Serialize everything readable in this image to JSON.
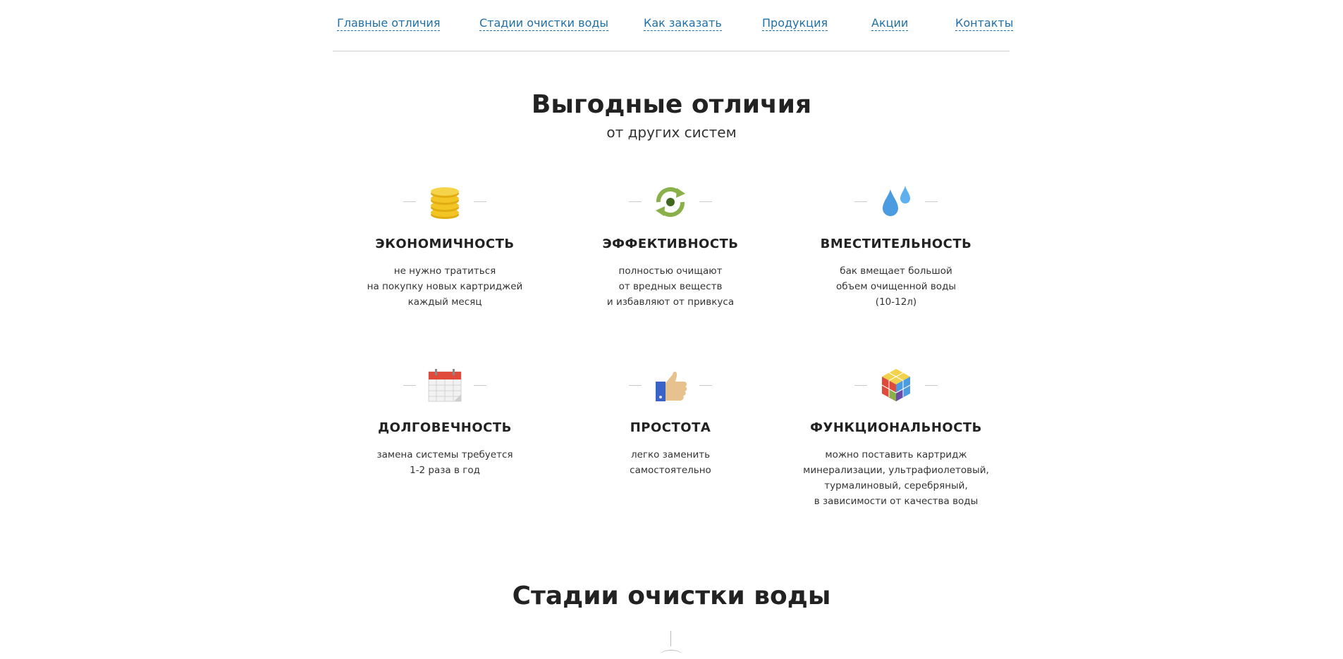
{
  "nav": {
    "items": [
      "Главные отличия",
      "Стадии очистки воды",
      "Как заказать",
      "Продукция",
      "Акции",
      "Контакты"
    ]
  },
  "benefits": {
    "title": "Выгодные отличия",
    "subtitle": "от других систем",
    "features": [
      {
        "icon": "coins-icon",
        "title": "ЭКОНОМИЧНОСТЬ",
        "lines": [
          "не нужно тратиться",
          "на покупку новых картриджей",
          "каждый месяц"
        ]
      },
      {
        "icon": "recycle-icon",
        "title": "ЭФФЕКТИВНОСТЬ",
        "lines": [
          "полностью очищают",
          "от вредных веществ",
          "и избавляют от привкуса"
        ]
      },
      {
        "icon": "water-drops-icon",
        "title": "ВМЕСТИТЕЛЬНОСТЬ",
        "lines": [
          "бак вмещает большой",
          "объем очищенной воды",
          "(10-12л)"
        ]
      },
      {
        "icon": "calendar-icon",
        "title": "ДОЛГОВЕЧНОСТЬ",
        "lines": [
          "замена системы требуется",
          "1-2 раза в год"
        ]
      },
      {
        "icon": "thumbs-up-icon",
        "title": "ПРОСТОТА",
        "lines": [
          "легко заменить",
          "самостоятельно"
        ]
      },
      {
        "icon": "cubes-icon",
        "title": "ФУНКЦИОНАЛЬНОСТЬ",
        "lines": [
          "можно поставить картридж",
          "минерализации, ультрафиолетовый,",
          "турмалиновый, серебряный,",
          "в зависимости от качества воды"
        ]
      }
    ]
  },
  "stages": {
    "title": "Стадии очистки воды"
  },
  "colors": {
    "link": "#1f6fa8",
    "heading": "#222222",
    "coin": "#f2c524",
    "recycle": "#8ab04a",
    "drop": "#4a9be0",
    "calendar_red": "#e04a3a",
    "thumb_blue": "#3a63c7"
  }
}
